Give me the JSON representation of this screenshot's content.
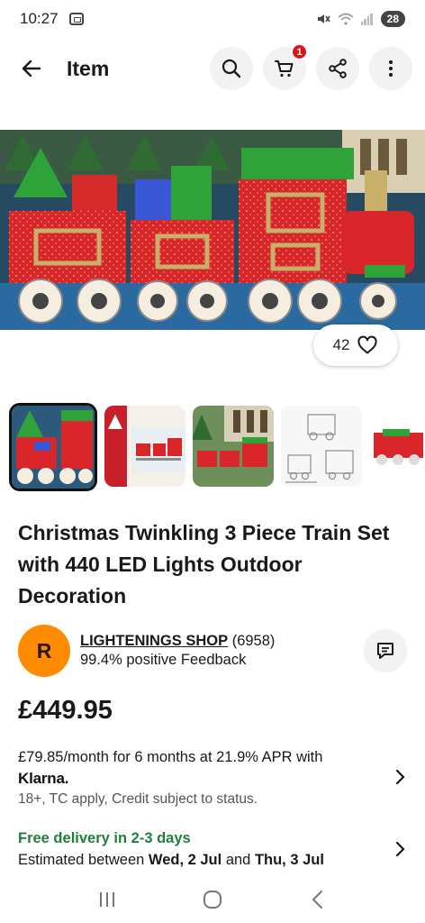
{
  "status_bar": {
    "time": "10:27",
    "battery": "28"
  },
  "header": {
    "title": "Item",
    "cart_count": "1",
    "icons": [
      "back-arrow-icon",
      "search-icon",
      "cart-icon",
      "share-icon",
      "more-vertical-icon"
    ]
  },
  "gallery": {
    "watch_count": "42",
    "thumbnails": [
      "train-photo",
      "box-packaging",
      "train-on-grass",
      "line-drawing-dimensions",
      "single-engine"
    ],
    "selected_index": 0
  },
  "item": {
    "title": "Christmas Twinkling 3 Piece Train Set with 440 LED Lights Outdoor Decoration",
    "price": "£449.95"
  },
  "seller": {
    "avatar_letter": "R",
    "name": "LIGHTENINGS SHOP",
    "score": "(6958)",
    "feedback": "99.4% positive Feedback"
  },
  "finance": {
    "line": "£79.85/month for 6 months at 21.9% APR with",
    "brand": "Klarna.",
    "terms": "18+, TC apply, Credit subject to status."
  },
  "delivery": {
    "free": "Free delivery in 2-3 days",
    "est_prefix": "Estimated between ",
    "date1": "Wed, 2 Jul",
    "and": " and ",
    "date2": "Thu, 3 Jul"
  },
  "colors": {
    "accent_red": "#e0121a",
    "avatar_orange": "#ff8c00",
    "delivery_green": "#1e7f3a"
  }
}
